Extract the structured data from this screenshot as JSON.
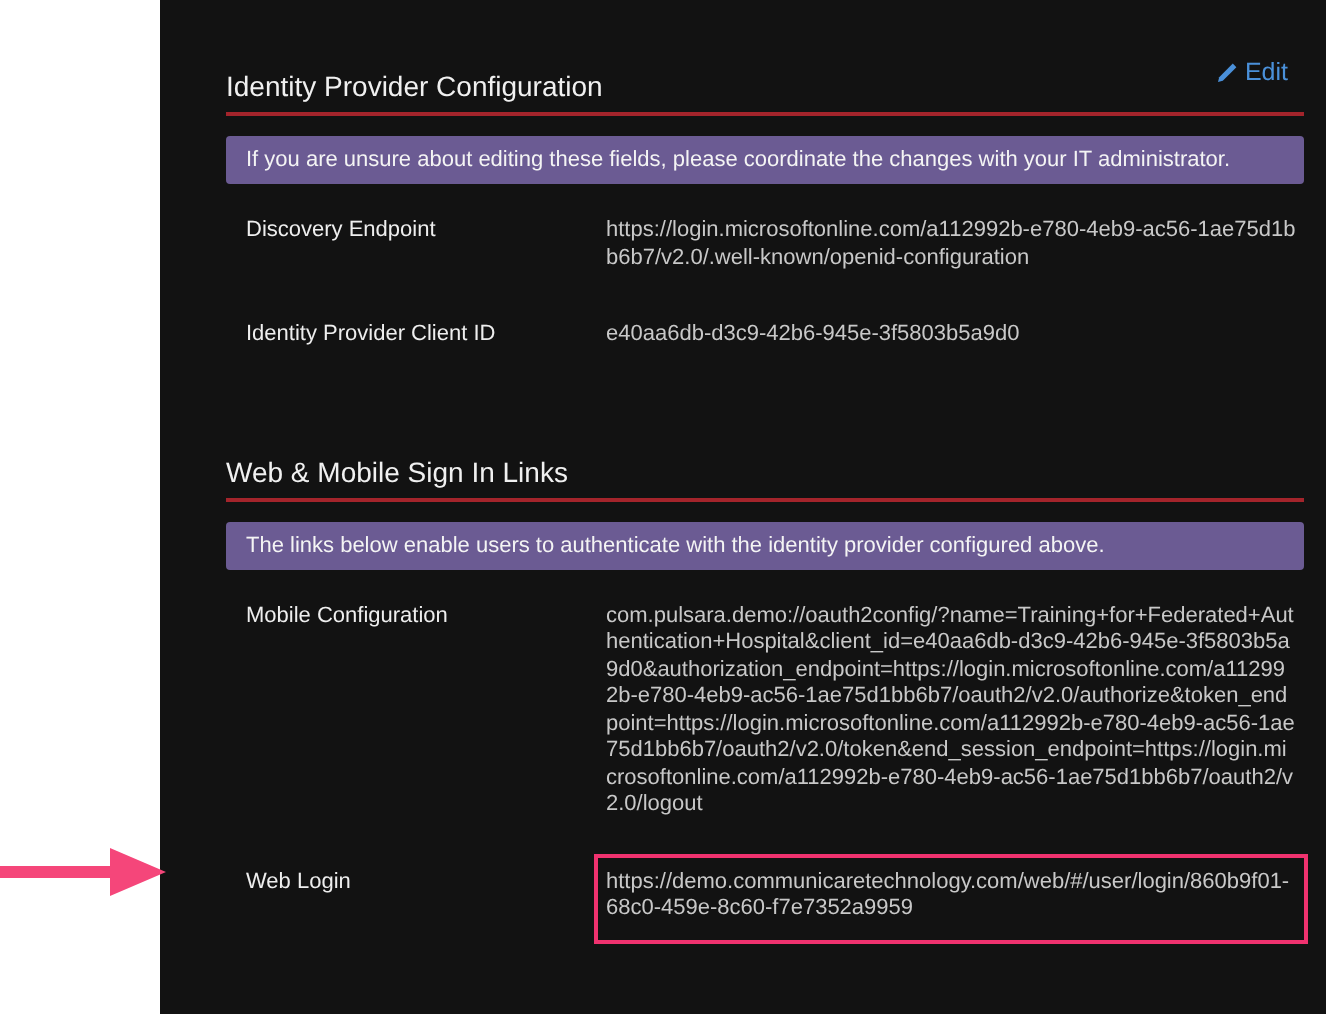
{
  "sections": [
    {
      "title": "Identity Provider Configuration",
      "edit_link": "Edit",
      "notice": "If you are unsure about editing these fields, please coordinate the changes with your IT administrator.",
      "rows": [
        {
          "label": "Discovery Endpoint",
          "value": "https://login.microsoftonline.com/a112992b-e780-4eb9-ac56-1ae75d1bb6b7/v2.0/.well-known/openid-configuration",
          "highlighted": false
        },
        {
          "label": "Identity Provider Client ID",
          "value": "e40aa6db-d3c9-42b6-945e-3f5803b5a9d0",
          "highlighted": false
        }
      ]
    },
    {
      "title": "Web & Mobile Sign In Links",
      "notice": "The links below enable users to authenticate with the identity provider configured above.",
      "rows": [
        {
          "label": "Mobile Configuration",
          "value": "com.pulsara.demo://oauth2config/?name=Training+for+Federated+Authentication+Hospital&client_id=e40aa6db-d3c9-42b6-945e-3f5803b5a9d0&authorization_endpoint=https://login.microsoftonline.com/a112992b-e780-4eb9-ac56-1ae75d1bb6b7/oauth2/v2.0/authorize&token_endpoint=https://login.microsoftonline.com/a112992b-e780-4eb9-ac56-1ae75d1bb6b7/oauth2/v2.0/token&end_session_endpoint=https://login.microsoftonline.com/a112992b-e780-4eb9-ac56-1ae75d1bb6b7/oauth2/v2.0/logout",
          "highlighted": false
        },
        {
          "label": "Web Login",
          "value": "https://demo.communicaretechnology.com/web/#/user/login/860b9f01-68c0-459e-8c60-f7e7352a9959",
          "highlighted": true
        }
      ]
    }
  ]
}
